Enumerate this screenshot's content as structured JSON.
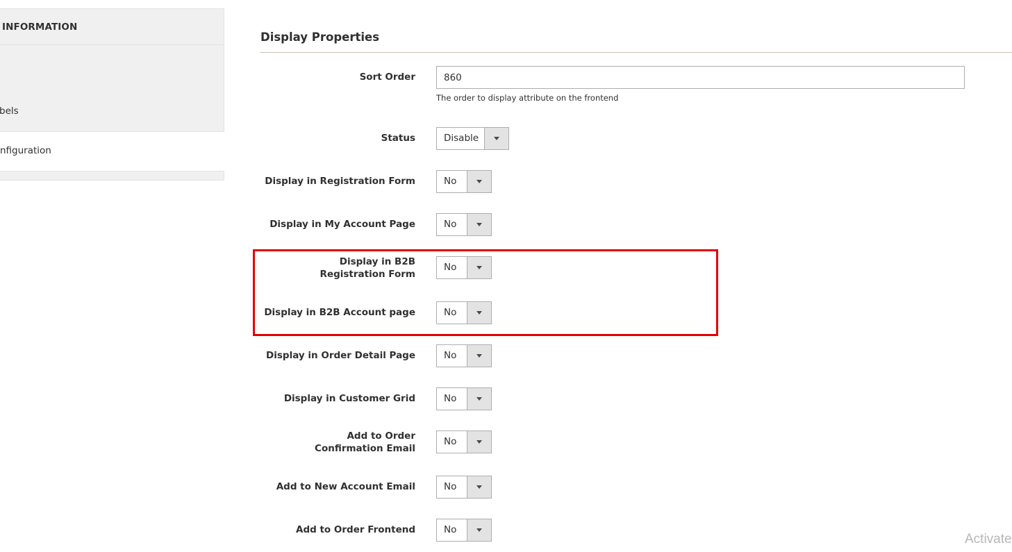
{
  "sidebar": {
    "header": "INFORMATION",
    "group_item": "bels",
    "plain_item": "nfiguration"
  },
  "section": {
    "title": "Display Properties"
  },
  "sort_order": {
    "label": "Sort Order",
    "value": "860",
    "note": "The order to display attribute on the frontend"
  },
  "status": {
    "label": "Status",
    "value": "Disable"
  },
  "fields": [
    {
      "label": "Display in Registration Form",
      "value": "No"
    },
    {
      "label": "Display in My Account Page",
      "value": "No"
    },
    {
      "label": "Display in B2B Registration Form",
      "value": "No"
    },
    {
      "label": "Display in B2B Account page",
      "value": "No"
    },
    {
      "label": "Display in Order Detail Page",
      "value": "No"
    },
    {
      "label": "Display in Customer Grid",
      "value": "No"
    },
    {
      "label": "Add to Order Confirmation Email",
      "value": "No"
    },
    {
      "label": "Add to New Account Email",
      "value": "No"
    },
    {
      "label": "Add to Order Frontend",
      "value": "No"
    }
  ],
  "highlight_color": "#e60000",
  "watermark": "Activate"
}
